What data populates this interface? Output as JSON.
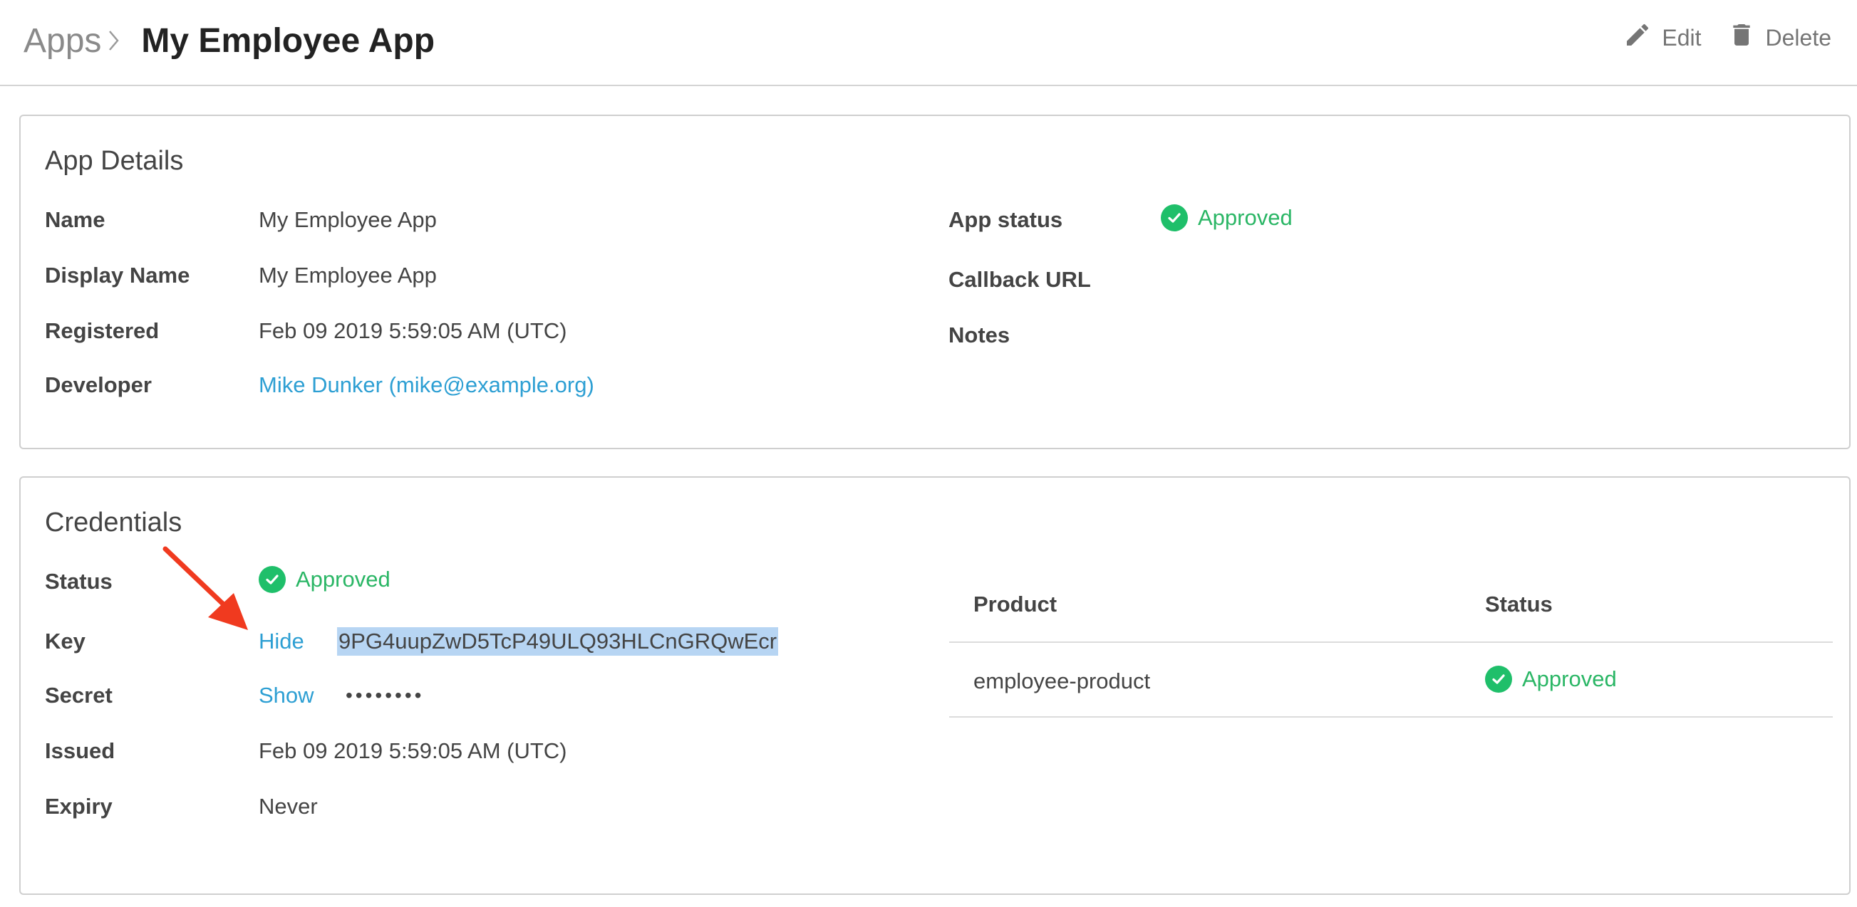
{
  "header": {
    "breadcrumb_apps": "Apps",
    "title": "My Employee App",
    "edit_label": "Edit",
    "delete_label": "Delete"
  },
  "app_details": {
    "title": "App Details",
    "rows": [
      {
        "label": "Name",
        "value": "My Employee App"
      },
      {
        "label": "Display Name",
        "value": "My Employee App"
      },
      {
        "label": "Registered",
        "value": "Feb 09 2019 5:59:05 AM (UTC)"
      },
      {
        "label": "Developer",
        "value": "Mike Dunker (mike@example.org)"
      }
    ],
    "right_rows": [
      {
        "label": "App status",
        "value": "Approved"
      },
      {
        "label": "Callback URL",
        "value": ""
      },
      {
        "label": "Notes",
        "value": ""
      }
    ]
  },
  "credentials": {
    "title": "Credentials",
    "status_label": "Status",
    "status_value": "Approved",
    "key_label": "Key",
    "key_toggle": "Hide",
    "key_value": "9PG4uupZwD5TcP49ULQ93HLCnGRQwEcr",
    "secret_label": "Secret",
    "secret_toggle": "Show",
    "secret_value": "••••••••",
    "issued_label": "Issued",
    "issued_value": "Feb 09 2019 5:59:05 AM (UTC)",
    "expiry_label": "Expiry",
    "expiry_value": "Never",
    "products_table": {
      "headers": [
        "Product",
        "Status"
      ],
      "rows": [
        {
          "product": "employee-product",
          "status": "Approved"
        }
      ]
    }
  },
  "colors": {
    "link": "#2d9fd3",
    "approved": "#2ab665",
    "highlight": "#b7d5f3",
    "annotation_arrow": "#f03a1f"
  },
  "icons": [
    "chevron-right-icon",
    "pencil-icon",
    "trash-icon",
    "check-circle-icon",
    "arrow-annotation"
  ]
}
